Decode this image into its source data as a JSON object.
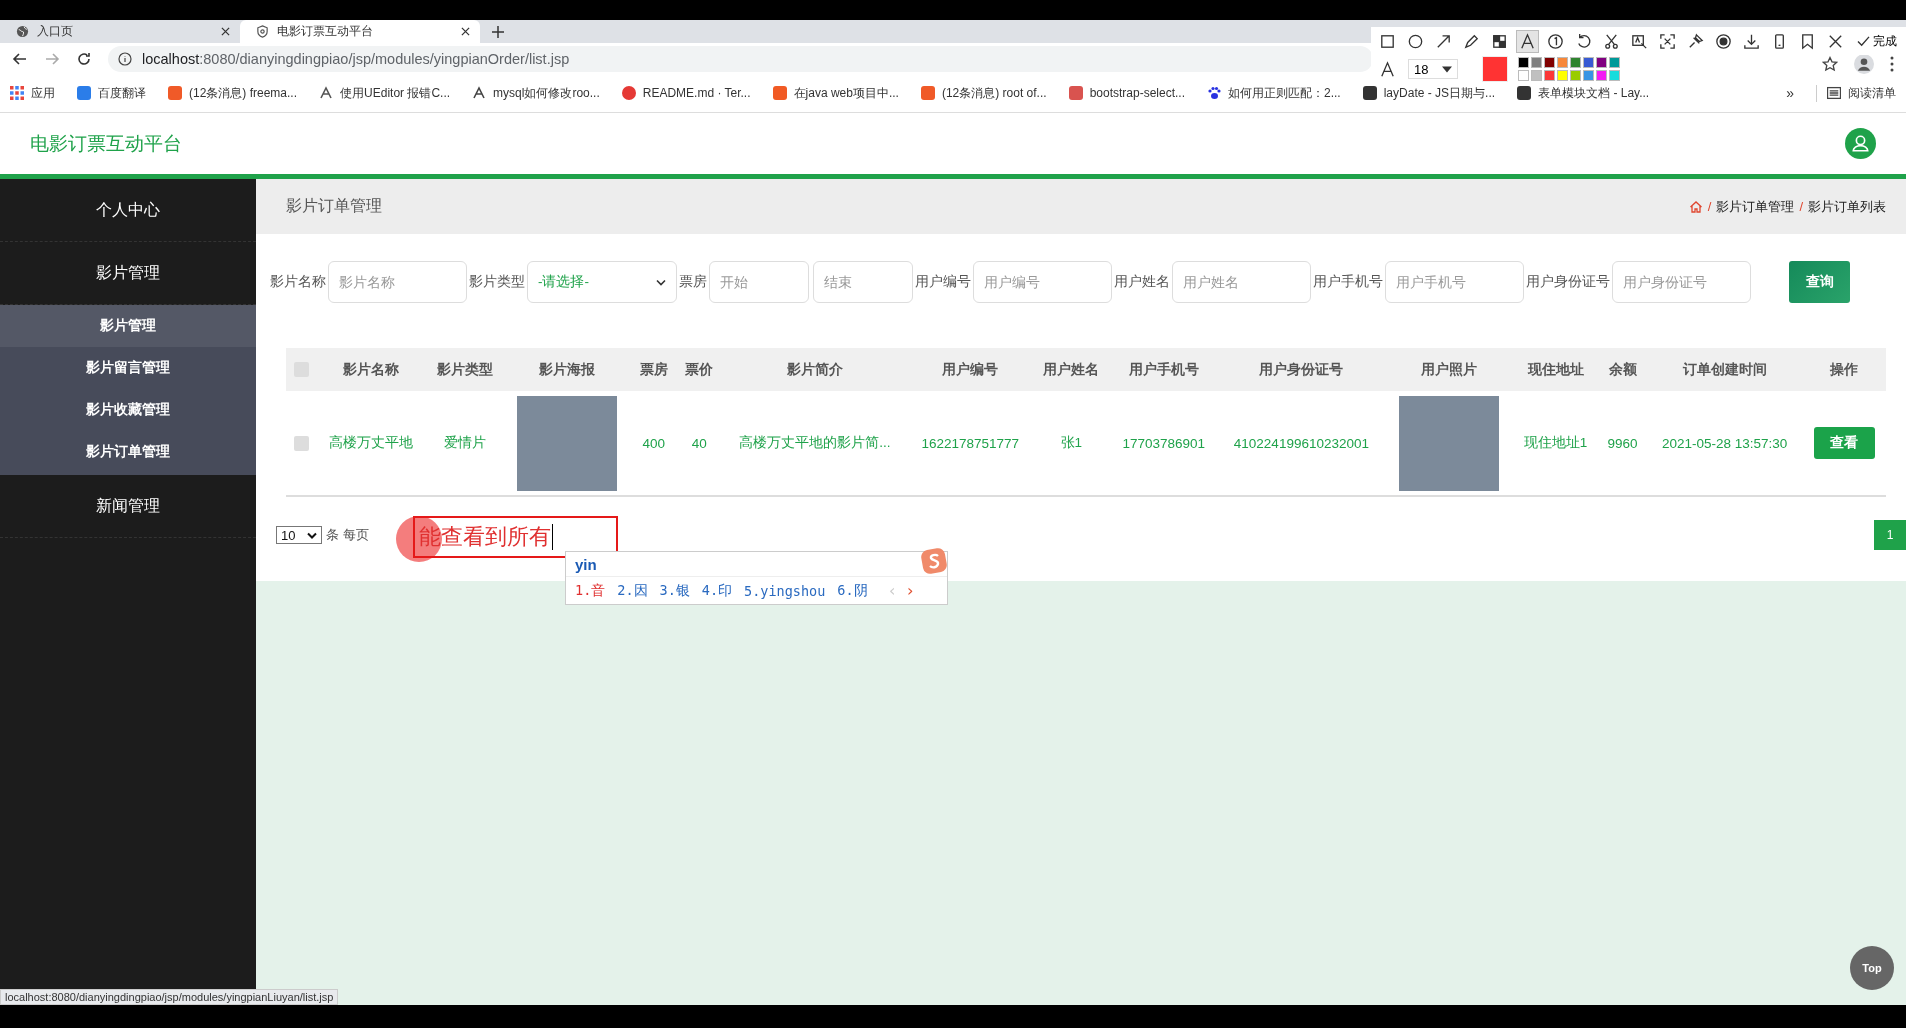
{
  "browser": {
    "tabs": [
      {
        "title": "入口页",
        "selected": false,
        "kind": "globe"
      },
      {
        "title": "电影订票互动平台",
        "selected": true,
        "kind": "shield"
      }
    ],
    "url": {
      "host": "localhost",
      "path": ":8080/dianyingdingpiao/jsp/modules/yingpianOrder/list.jsp"
    },
    "bookmarks": [
      {
        "label": "应用",
        "kind": "grid",
        "color": "#e8453c"
      },
      {
        "label": "百度翻译",
        "kind": "square",
        "color": "#2b7de9"
      },
      {
        "label": "(12条消息) freema...",
        "kind": "square",
        "color": "#f05a28"
      },
      {
        "label": "使用UEditor 报错C...",
        "kind": "swirl",
        "color": "#555555"
      },
      {
        "label": "mysql如何修改roo...",
        "kind": "swirl",
        "color": "#444444"
      },
      {
        "label": "README.md · Ter...",
        "kind": "round",
        "color": "#e53935"
      },
      {
        "label": "在java web项目中...",
        "kind": "square",
        "color": "#f15a24"
      },
      {
        "label": "(12条消息) root of...",
        "kind": "square",
        "color": "#f05a28"
      },
      {
        "label": "bootstrap-select...",
        "kind": "square",
        "color": "#d9534f"
      },
      {
        "label": "如何用正则匹配：2...",
        "kind": "paw",
        "color": "#2932e1"
      },
      {
        "label": "layDate - JS日期与...",
        "kind": "square",
        "color": "#333333"
      },
      {
        "label": "表单模块文档 - Lay...",
        "kind": "square",
        "color": "#333333"
      }
    ],
    "more": "»",
    "reading_list": "阅读清单"
  },
  "capture_toolbar": {
    "tools": [
      {
        "kind": "rect",
        "selected": false
      },
      {
        "kind": "circle",
        "selected": false
      },
      {
        "kind": "arrow",
        "selected": false
      },
      {
        "kind": "pencil",
        "selected": false
      },
      {
        "kind": "mosaic",
        "selected": false
      },
      {
        "kind": "text",
        "selected": true
      },
      {
        "kind": "number",
        "selected": false
      },
      {
        "kind": "undo",
        "selected": false
      },
      {
        "kind": "scissors",
        "selected": false
      },
      {
        "kind": "ocr",
        "selected": false
      },
      {
        "kind": "crop",
        "selected": false
      },
      {
        "kind": "pin",
        "selected": false
      },
      {
        "kind": "record",
        "selected": false
      },
      {
        "kind": "download",
        "selected": false
      },
      {
        "kind": "phone",
        "selected": false
      },
      {
        "kind": "bookmark",
        "selected": false
      },
      {
        "kind": "close",
        "selected": false
      }
    ],
    "done": "完成",
    "font_size": "18",
    "swatches": [
      {
        "color": "#000000"
      },
      {
        "color": "#808080"
      },
      {
        "color": "#800000"
      },
      {
        "color": "#f7883a"
      },
      {
        "color": "#308430"
      },
      {
        "color": "#385ad3"
      },
      {
        "color": "#800080"
      },
      {
        "color": "#009999"
      },
      {
        "color": "#ffffff"
      },
      {
        "color": "#c0c0c0"
      },
      {
        "color": "#fb3838"
      },
      {
        "color": "#ffff00"
      },
      {
        "color": "#99cc00"
      },
      {
        "color": "#3894e4"
      },
      {
        "color": "#f31bf3"
      },
      {
        "color": "#16dcdc"
      }
    ]
  },
  "app": {
    "title": "电影订票互动平台"
  },
  "sidebar": {
    "items": [
      {
        "label": "个人中心"
      },
      {
        "label": "影片管理",
        "children": [
          {
            "label": "影片管理",
            "selected": true
          },
          {
            "label": "影片留言管理",
            "selected": false
          },
          {
            "label": "影片收藏管理",
            "selected": false
          },
          {
            "label": "影片订单管理",
            "selected": false
          }
        ]
      },
      {
        "label": "新闻管理"
      }
    ]
  },
  "page": {
    "title": "影片订单管理",
    "breadcrumb": [
      {
        "separator": "/",
        "label": "影片订单管理"
      },
      {
        "separator": "/",
        "label": "影片订单列表"
      }
    ]
  },
  "filters": [
    {
      "label": "影片名称",
      "fields": [
        {
          "kind": "text",
          "placeholder": "影片名称"
        }
      ]
    },
    {
      "label": "影片类型",
      "fields": [
        {
          "kind": "select",
          "value": "-请选择-"
        }
      ]
    },
    {
      "label": "票房",
      "fields": [
        {
          "kind": "short",
          "placeholder": "开始"
        },
        {
          "kind": "short",
          "placeholder": "结束"
        }
      ]
    },
    {
      "label": "用户编号",
      "fields": [
        {
          "kind": "text",
          "placeholder": "用户编号"
        }
      ]
    },
    {
      "label": "用户姓名",
      "fields": [
        {
          "kind": "text",
          "placeholder": "用户姓名"
        }
      ]
    },
    {
      "label": "用户手机号",
      "fields": [
        {
          "kind": "text",
          "placeholder": "用户手机号"
        }
      ]
    },
    {
      "label": "用户身份证号",
      "fields": [
        {
          "kind": "text",
          "placeholder": "用户身份证号"
        }
      ]
    }
  ],
  "search_button": "查询",
  "table": {
    "columns": [
      {
        "kind": "check",
        "checked": false
      },
      {
        "kind": "text",
        "label": "影片名称"
      },
      {
        "kind": "text",
        "label": "影片类型"
      },
      {
        "kind": "text",
        "label": "影片海报"
      },
      {
        "kind": "text",
        "label": "票房"
      },
      {
        "kind": "text",
        "label": "票价"
      },
      {
        "kind": "text",
        "label": "影片简介"
      },
      {
        "kind": "text",
        "label": "用户编号"
      },
      {
        "kind": "text",
        "label": "用户姓名"
      },
      {
        "kind": "text",
        "label": "用户手机号"
      },
      {
        "kind": "text",
        "label": "用户身份证号"
      },
      {
        "kind": "text",
        "label": "用户照片"
      },
      {
        "kind": "text",
        "label": "现住地址"
      },
      {
        "kind": "text",
        "label": "余额"
      },
      {
        "kind": "text",
        "label": "订单创建时间"
      },
      {
        "kind": "text",
        "label": "操作"
      }
    ],
    "rows": [
      {
        "cells": [
          {
            "kind": "check",
            "checked": false
          },
          {
            "kind": "text",
            "text": "高楼万丈平地"
          },
          {
            "kind": "text",
            "text": "爱情片"
          },
          {
            "kind": "image"
          },
          {
            "kind": "text",
            "text": "400"
          },
          {
            "kind": "text",
            "text": "40"
          },
          {
            "kind": "text",
            "text": "高楼万丈平地的影片简..."
          },
          {
            "kind": "text",
            "text": "1622178751777"
          },
          {
            "kind": "text",
            "text": "张1"
          },
          {
            "kind": "text",
            "text": "17703786901"
          },
          {
            "kind": "text",
            "text": "410224199610232001"
          },
          {
            "kind": "image"
          },
          {
            "kind": "text",
            "text": "现住地址1"
          },
          {
            "kind": "text",
            "text": "9960"
          },
          {
            "kind": "text",
            "text": "2021-05-28 13:57:30"
          },
          {
            "kind": "button",
            "text": "查看"
          }
        ]
      }
    ]
  },
  "pagination": {
    "page_size": "10",
    "page_size_label": "条 每页",
    "pages": [
      {
        "label": "1",
        "selected": true
      }
    ]
  },
  "annotation": {
    "text": "能查看到所有"
  },
  "ime": {
    "input": "yin",
    "candidates": [
      {
        "text": "1.音",
        "selected": true
      },
      {
        "text": "2.因",
        "selected": false
      },
      {
        "text": "3.银",
        "selected": false
      },
      {
        "text": "4.印",
        "selected": false
      },
      {
        "text": "5.yingshou",
        "selected": false
      },
      {
        "text": "6.阴",
        "selected": false
      }
    ],
    "prev": "‹",
    "next": "›"
  },
  "status_url": "localhost:8080/dianyingdingpiao/jsp/modules/yingpianLiuyan/list.jsp",
  "top_button": "Top"
}
